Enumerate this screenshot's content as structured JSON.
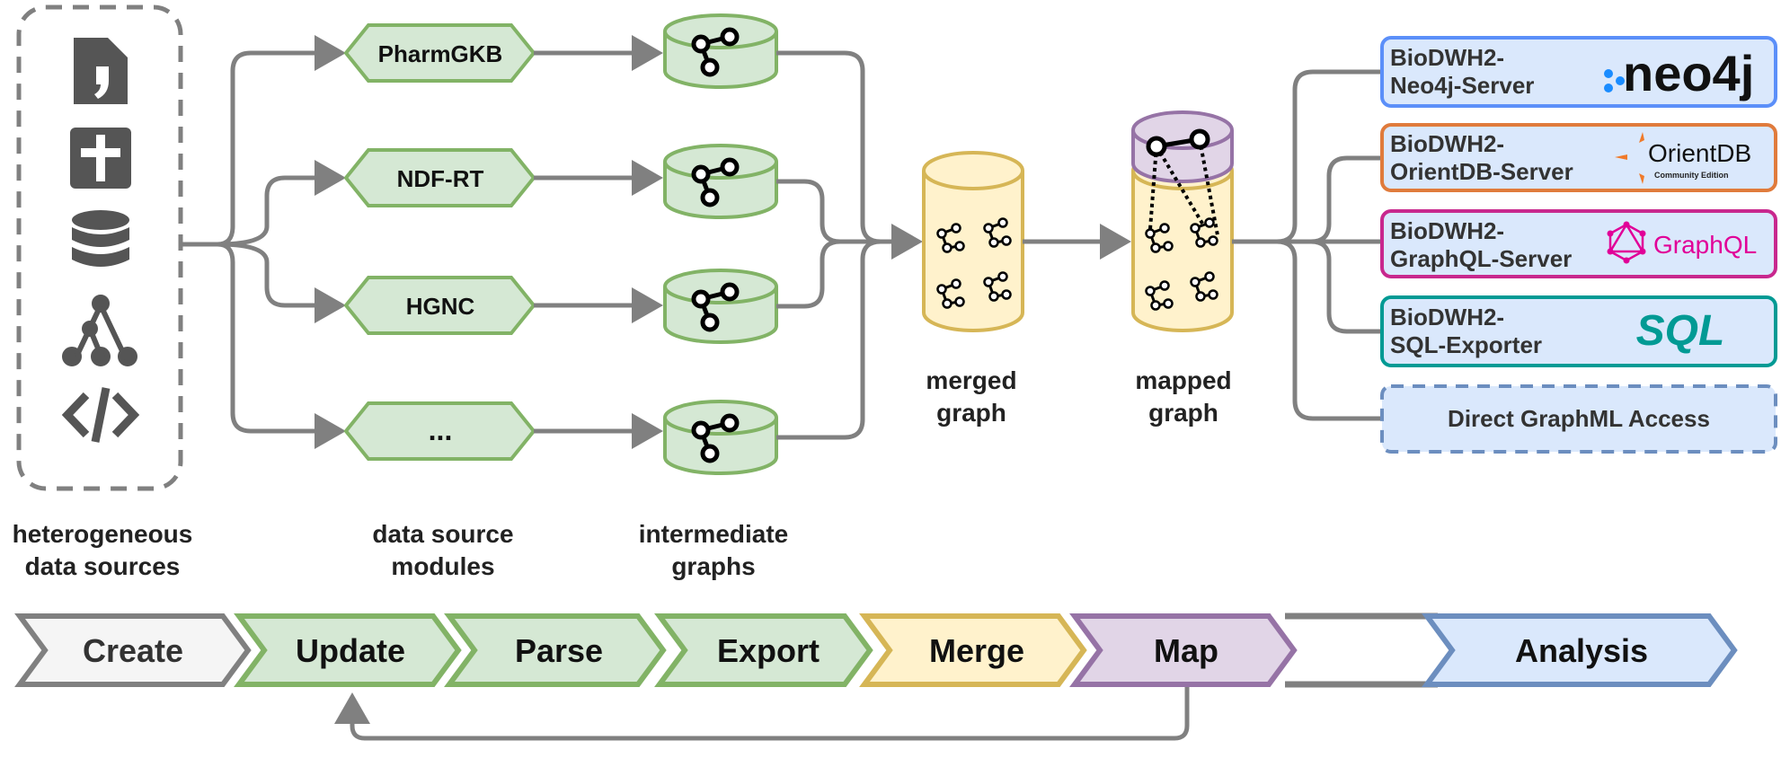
{
  "colors": {
    "connector": "#808080",
    "module_fill": "#d5e8d4",
    "module_stroke": "#82b366",
    "merge_fill": "#fff2cc",
    "merge_stroke": "#d6b656",
    "map_fill": "#e1d5e7",
    "map_stroke": "#9673a6",
    "analysis_fill": "#dae8fc",
    "analysis_stroke": "#6c8ebf",
    "create_fill": "#f5f5f5"
  },
  "sources": {
    "icons": [
      "file-quote-icon",
      "medical-cross-icon",
      "database-icon",
      "tree-hierarchy-icon",
      "code-icon"
    ],
    "label_line1": "heterogeneous",
    "label_line2": "data sources"
  },
  "modules": {
    "items": [
      "PharmGKB",
      "NDF-RT",
      "HGNC",
      "..."
    ],
    "label_line1": "data source",
    "label_line2": "modules"
  },
  "intermediate": {
    "label_line1": "intermediate",
    "label_line2": "graphs"
  },
  "merged": {
    "label_line1": "merged",
    "label_line2": "graph"
  },
  "mapped": {
    "label_line1": "mapped",
    "label_line2": "graph"
  },
  "targets": [
    {
      "line1": "BioDWH2-",
      "line2": "Neo4j-Server",
      "logo": "neo4j",
      "color": "#5b8ff9"
    },
    {
      "line1": "BioDWH2-",
      "line2": "OrientDB-Server",
      "logo": "OrientDB",
      "logo_sub": "Community Edition",
      "color": "#e07b3c"
    },
    {
      "line1": "BioDWH2-",
      "line2": "GraphQL-Server",
      "logo": "GraphQL",
      "color": "#c8288e"
    },
    {
      "line1": "BioDWH2-",
      "line2": "SQL-Exporter",
      "logo": "SQL",
      "color": "#009a94"
    },
    {
      "line1": "Direct GraphML Access",
      "color": "#6c8ebf"
    }
  ],
  "pipeline": [
    "Create",
    "Update",
    "Parse",
    "Export",
    "Merge",
    "Map",
    "Analysis"
  ]
}
